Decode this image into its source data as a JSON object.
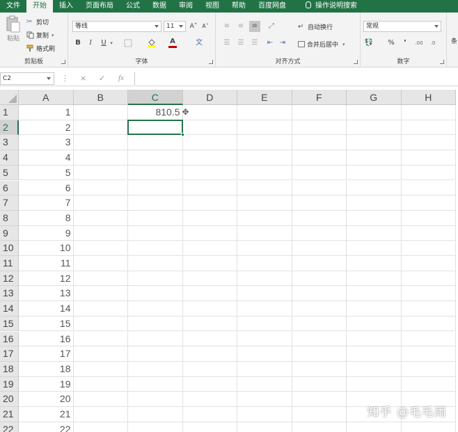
{
  "menu": {
    "tabs": [
      "文件",
      "开始",
      "插入",
      "页面布局",
      "公式",
      "数据",
      "审阅",
      "视图",
      "帮助",
      "百度网盘"
    ],
    "active_index": 1,
    "tell_me": "操作说明搜索"
  },
  "ribbon": {
    "clipboard": {
      "label": "剪贴板",
      "paste": "粘贴",
      "cut": "剪切",
      "copy": "复制",
      "format_painter": "格式刷"
    },
    "font": {
      "label": "字体",
      "name": "等线",
      "size": "11",
      "bold": "B",
      "italic": "I",
      "underline": "U",
      "grow": "A˄",
      "shrink": "A˅",
      "font_color": "A",
      "wen": "文"
    },
    "alignment": {
      "label": "对齐方式",
      "wrap": "自动换行",
      "merge": "合并后居中"
    },
    "number": {
      "label": "数字",
      "format": "常规",
      "percent": "%",
      "comma": "’"
    },
    "extra": {
      "label": "条"
    }
  },
  "formula_bar": {
    "name_box": "C2",
    "fx": "fx",
    "cancel": "×",
    "enter": "✓",
    "value": ""
  },
  "grid": {
    "columns": [
      "A",
      "B",
      "C",
      "D",
      "E",
      "F",
      "G",
      "H"
    ],
    "selected_column": "C",
    "selected_row": 2,
    "rows": [
      {
        "n": "1",
        "a": "1",
        "c": "810.5"
      },
      {
        "n": "2",
        "a": "2",
        "c": ""
      },
      {
        "n": "3",
        "a": "3",
        "c": ""
      },
      {
        "n": "4",
        "a": "4",
        "c": ""
      },
      {
        "n": "5",
        "a": "5",
        "c": ""
      },
      {
        "n": "6",
        "a": "6",
        "c": ""
      },
      {
        "n": "7",
        "a": "7",
        "c": ""
      },
      {
        "n": "8",
        "a": "8",
        "c": ""
      },
      {
        "n": "9",
        "a": "9",
        "c": ""
      },
      {
        "n": "10",
        "a": "10",
        "c": ""
      },
      {
        "n": "11",
        "a": "11",
        "c": ""
      },
      {
        "n": "12",
        "a": "12",
        "c": ""
      },
      {
        "n": "13",
        "a": "13",
        "c": ""
      },
      {
        "n": "14",
        "a": "14",
        "c": ""
      },
      {
        "n": "15",
        "a": "15",
        "c": ""
      },
      {
        "n": "16",
        "a": "16",
        "c": ""
      },
      {
        "n": "17",
        "a": "17",
        "c": ""
      },
      {
        "n": "18",
        "a": "18",
        "c": ""
      },
      {
        "n": "19",
        "a": "19",
        "c": ""
      },
      {
        "n": "20",
        "a": "20",
        "c": ""
      },
      {
        "n": "21",
        "a": "21",
        "c": ""
      },
      {
        "n": "22",
        "a": "22",
        "c": ""
      }
    ]
  },
  "watermark": "知乎 @毛毛雨",
  "colors": {
    "accent": "#217346",
    "header_bg": "#e6e6e6",
    "ribbon_bg": "#f3f3f3",
    "font_color_bar": "#c00000",
    "fill_color_bar": "#ffff00"
  }
}
